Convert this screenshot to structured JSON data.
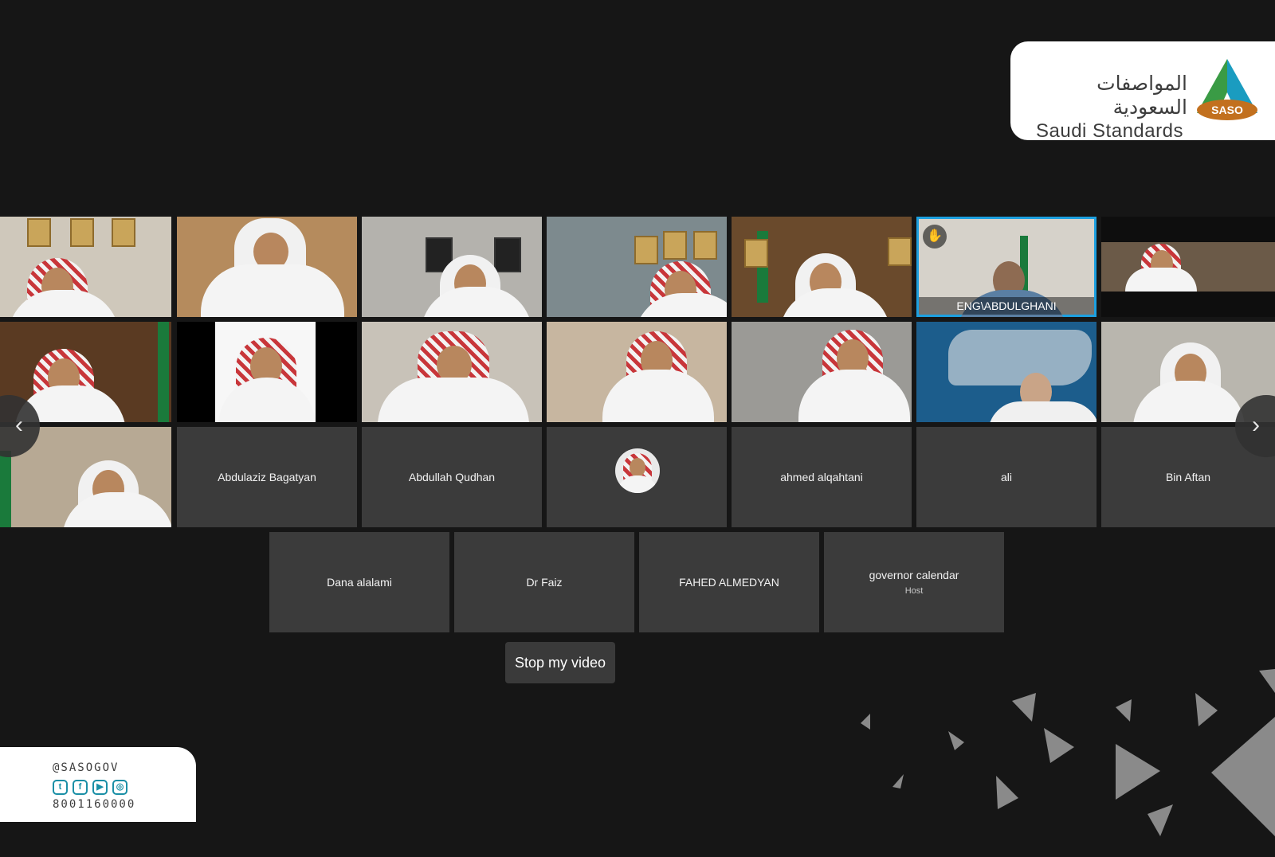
{
  "brand": {
    "arabic_name": "المواصفات السعودية",
    "english_name": "Saudi Standards",
    "logo_badge": "SASO"
  },
  "participants": {
    "active_speaker": "ENG\\ABDULGHANI",
    "name_tiles": [
      {
        "name": "Abdulaziz Bagatyan"
      },
      {
        "name": "Abdullah Qudhan"
      },
      {
        "name": "ahmed alqahtani"
      },
      {
        "name": "ali"
      },
      {
        "name": "Bin Aftan"
      },
      {
        "name": "Dana alalami"
      },
      {
        "name": "Dr Faiz"
      },
      {
        "name": "FAHED ALMEDYAN"
      },
      {
        "name": "governor calendar",
        "role": "Host"
      }
    ]
  },
  "controls": {
    "stop_video_label": "Stop my video",
    "prev_icon": "chevron-left-icon",
    "next_icon": "chevron-right-icon"
  },
  "footer": {
    "handle": "@SASOGOV",
    "phone": "8001160000",
    "social_icons": [
      "twitter-icon",
      "facebook-icon",
      "youtube-icon",
      "instagram-icon"
    ]
  },
  "colors": {
    "background": "#161616",
    "tile": "#3b3b3b",
    "active_border": "#1da0e0",
    "brand_teal": "#1a8fa6",
    "brand_green": "#3a9b45",
    "brand_orange": "#c2701e"
  }
}
